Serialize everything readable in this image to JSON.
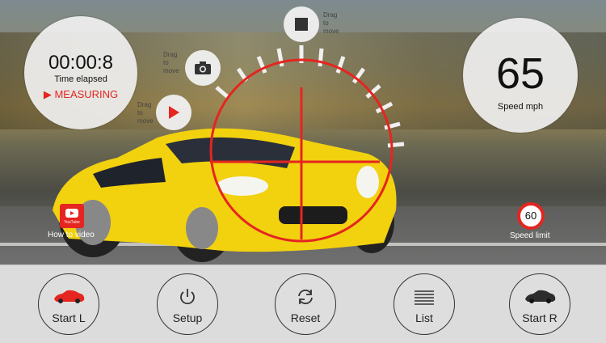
{
  "timer": {
    "time": "00:00:8",
    "label": "Time elapsed",
    "status": "MEASURING"
  },
  "speed": {
    "value": "65",
    "label": "Speed mph"
  },
  "drag_hints": [
    "Drag to move",
    "Drag to move",
    "Drag to move"
  ],
  "video": {
    "badge": "YouTube",
    "label": "How to video"
  },
  "speed_limit": {
    "value": "60",
    "label": "Speed limit"
  },
  "toolbar": {
    "start_left": "Start L",
    "setup": "Setup",
    "reset": "Reset",
    "list": "List",
    "start_right": "Start R"
  },
  "colors": {
    "accent": "#e52520",
    "car": "#f2d10f"
  }
}
